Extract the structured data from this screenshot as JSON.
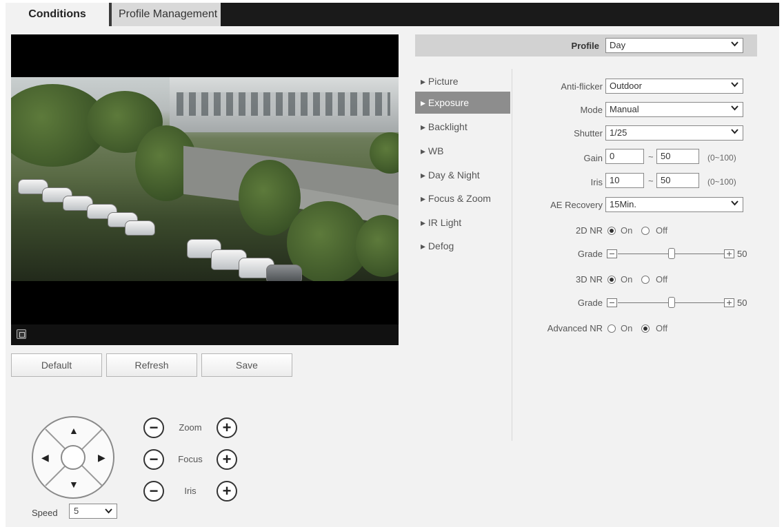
{
  "tabs": [
    {
      "label": "Conditions",
      "active": true
    },
    {
      "label": "Profile Management",
      "active": false
    }
  ],
  "buttons": {
    "default": "Default",
    "refresh": "Refresh",
    "save": "Save"
  },
  "ptz": {
    "speed_label": "Speed",
    "speed_value": "5",
    "zoom_label": "Zoom",
    "focus_label": "Focus",
    "iris_label": "Iris",
    "minus": "−",
    "plus": "+",
    "up": "▲",
    "down": "▼",
    "left": "◀",
    "right": "▶"
  },
  "profile": {
    "label": "Profile",
    "value": "Day"
  },
  "menu": {
    "items": [
      {
        "label": "▸ Picture"
      },
      {
        "label": "▸ Exposure",
        "active": true
      },
      {
        "label": "▸ Backlight"
      },
      {
        "label": "▸ WB"
      },
      {
        "label": "▸ Day & Night"
      },
      {
        "label": "▸ Focus & Zoom"
      },
      {
        "label": "▸ IR Light"
      },
      {
        "label": "▸ Defog"
      }
    ]
  },
  "exposure": {
    "anti_flicker": {
      "label": "Anti-flicker",
      "value": "Outdoor"
    },
    "mode": {
      "label": "Mode",
      "value": "Manual"
    },
    "shutter": {
      "label": "Shutter",
      "value": "1/25"
    },
    "gain": {
      "label": "Gain",
      "min": "0",
      "max": "50",
      "tilde": "~",
      "range": "(0~100)"
    },
    "iris": {
      "label": "Iris",
      "min": "10",
      "max": "50",
      "tilde": "~",
      "range": "(0~100)"
    },
    "ae_recovery": {
      "label": "AE Recovery",
      "value": "15Min."
    },
    "nr2d": {
      "label": "2D NR",
      "on": "On",
      "off": "Off",
      "selected": "On"
    },
    "grade1": {
      "label": "Grade",
      "value": "50"
    },
    "nr3d": {
      "label": "3D NR",
      "on": "On",
      "off": "Off",
      "selected": "On"
    },
    "grade2": {
      "label": "Grade",
      "value": "50"
    },
    "advanced_nr": {
      "label": "Advanced NR",
      "on": "On",
      "off": "Off",
      "selected": "Off"
    }
  },
  "colors": {
    "tab_bar": "#1a1a1a",
    "panel_bg": "#f2f2f2",
    "active_menu": "#8d8d8d",
    "profile_bar": "#d2d2d2"
  },
  "icons": {
    "fullscreen": "fullscreen-icon",
    "dropdown": "chevron-down-icon"
  }
}
